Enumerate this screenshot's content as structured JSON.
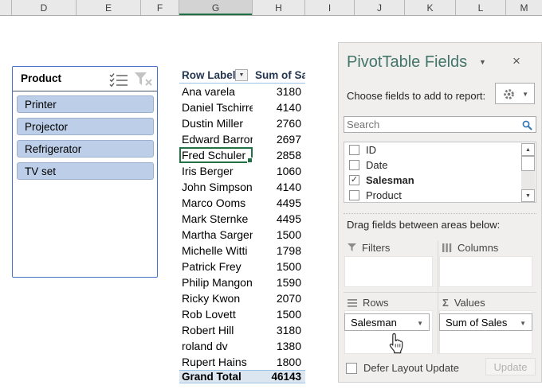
{
  "colors": {
    "excel_green": "#1E7145",
    "pane_title_green": "#44756A",
    "slicer_border_blue": "#4472C4",
    "slicer_item_blue": "#BCCEE8",
    "grand_total_blue": "#DCE6F1",
    "pivot_border_blue": "#9DC3E6",
    "search_icon_blue": "#2E75B6"
  },
  "spreadsheet": {
    "column_letters": [
      "D",
      "E",
      "F",
      "G",
      "H",
      "I",
      "J",
      "K",
      "L",
      "M"
    ],
    "selected_column": "G"
  },
  "slicer": {
    "title": "Product",
    "items": [
      "Printer",
      "Projector",
      "Refrigerator",
      "TV set"
    ]
  },
  "pivot_table": {
    "header": {
      "row_labels": "Row Labels",
      "sum_label": "Sum of Sa"
    },
    "rows": [
      {
        "name": "Ana varela",
        "value": 3180
      },
      {
        "name": "Daniel Tschirre",
        "value": 4140
      },
      {
        "name": "Dustin Miller",
        "value": 2760
      },
      {
        "name": "Edward Barron",
        "value": 2697
      },
      {
        "name": "Fred Schuler",
        "value": 2858
      },
      {
        "name": "Iris Berger",
        "value": 1060
      },
      {
        "name": "John Simpson",
        "value": 4140
      },
      {
        "name": "Marco Ooms",
        "value": 4495
      },
      {
        "name": "Mark Sternke",
        "value": 4495
      },
      {
        "name": "Martha Sargen",
        "value": 1500
      },
      {
        "name": "Michelle Witti",
        "value": 1798
      },
      {
        "name": "Patrick Frey",
        "value": 1500
      },
      {
        "name": "Philip Mangon",
        "value": 1590
      },
      {
        "name": "Ricky Kwon",
        "value": 2070
      },
      {
        "name": "Rob Lovett",
        "value": 1500
      },
      {
        "name": "Robert Hill",
        "value": 3180
      },
      {
        "name": "roland dv",
        "value": 1380
      },
      {
        "name": "Rupert Hains",
        "value": 1800
      }
    ],
    "grand_total": {
      "label": "Grand Total",
      "value": 46143
    },
    "selected_cell": "Fred Schuler"
  },
  "fields_pane": {
    "title": "PivotTable Fields",
    "choose_label": "Choose fields to add to report:",
    "search_placeholder": "Search",
    "fields": [
      {
        "label": "ID",
        "check": ""
      },
      {
        "label": "Date",
        "check": ""
      },
      {
        "label": "Salesman",
        "check": "✓"
      },
      {
        "label": "Product",
        "check": ""
      }
    ],
    "drag_label": "Drag fields between areas below:",
    "areas": {
      "filters": "Filters",
      "columns": "Columns",
      "rows": "Rows",
      "values": "Values"
    },
    "rows_field": "Salesman",
    "values_field": "Sum of Sales",
    "defer_label": "Defer Layout Update",
    "update_label": "Update"
  }
}
